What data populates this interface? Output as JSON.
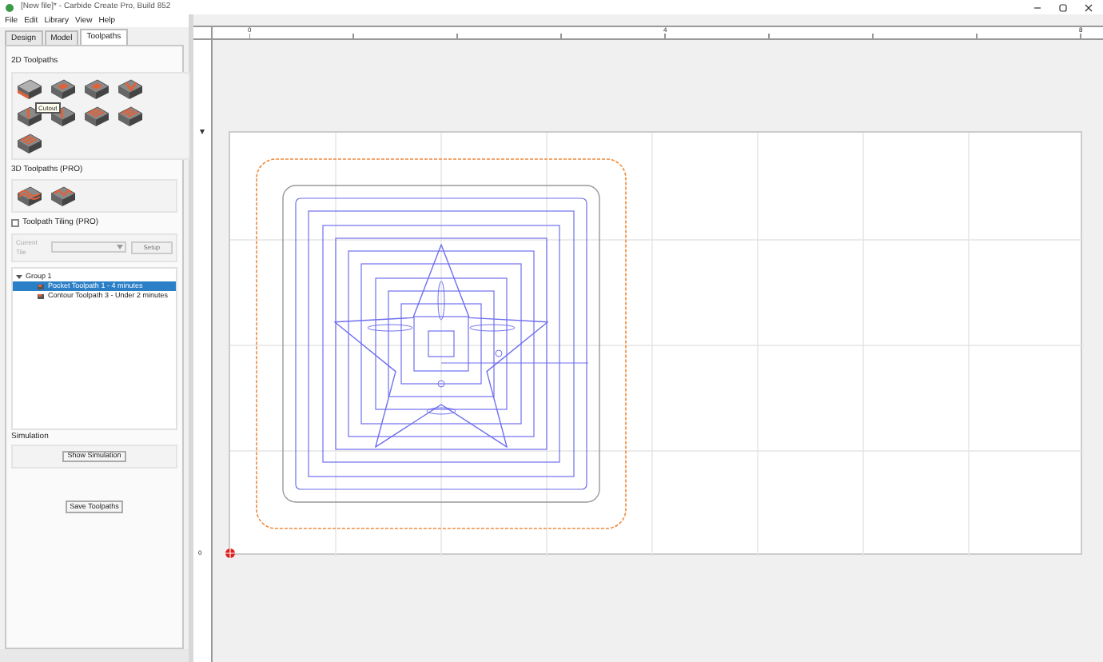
{
  "window": {
    "title": "[New file]* - Carbide Create Pro, Build 852"
  },
  "menu": [
    "File",
    "Edit",
    "Library",
    "View",
    "Help"
  ],
  "tabs": [
    {
      "label": "Design",
      "selected": false
    },
    {
      "label": "Model",
      "selected": false
    },
    {
      "label": "Toolpaths",
      "selected": true
    }
  ],
  "toolpaths_2d": {
    "title": "2D Toolpaths",
    "tools": [
      {
        "kind": "contour"
      },
      {
        "kind": "pocket"
      },
      {
        "kind": "pocket"
      },
      {
        "kind": "vcarve"
      },
      {
        "kind": "drill"
      },
      {
        "kind": "drill"
      },
      {
        "kind": "texture"
      },
      {
        "kind": "texture"
      },
      {
        "kind": "texture"
      }
    ],
    "tooltip": "Cutout"
  },
  "toolpaths_3d": {
    "title": "3D Toolpaths (PRO)",
    "tools": [
      {
        "kind": "rough"
      },
      {
        "kind": "finish"
      }
    ]
  },
  "tiling": {
    "label": "Toolpath Tiling (PRO)",
    "checked": false,
    "current_tile_label": "Current Tile",
    "setup_button": {
      "label": "Setup",
      "disabled": true
    }
  },
  "tree": [
    {
      "label": "Group 1",
      "expanded": true,
      "children": [
        {
          "label": "Pocket Toolpath 1 - 4 minutes",
          "selected": true
        },
        {
          "label": "Contour Toolpath 3 - Under 2 minutes",
          "selected": false
        }
      ]
    }
  ],
  "simulation": {
    "title": "Simulation",
    "button": "Show Simulation"
  },
  "save_button": "Save Toolpaths",
  "ruler": {
    "top_labels": [
      "0",
      "4",
      "8"
    ],
    "left_labels": [
      "0"
    ]
  }
}
